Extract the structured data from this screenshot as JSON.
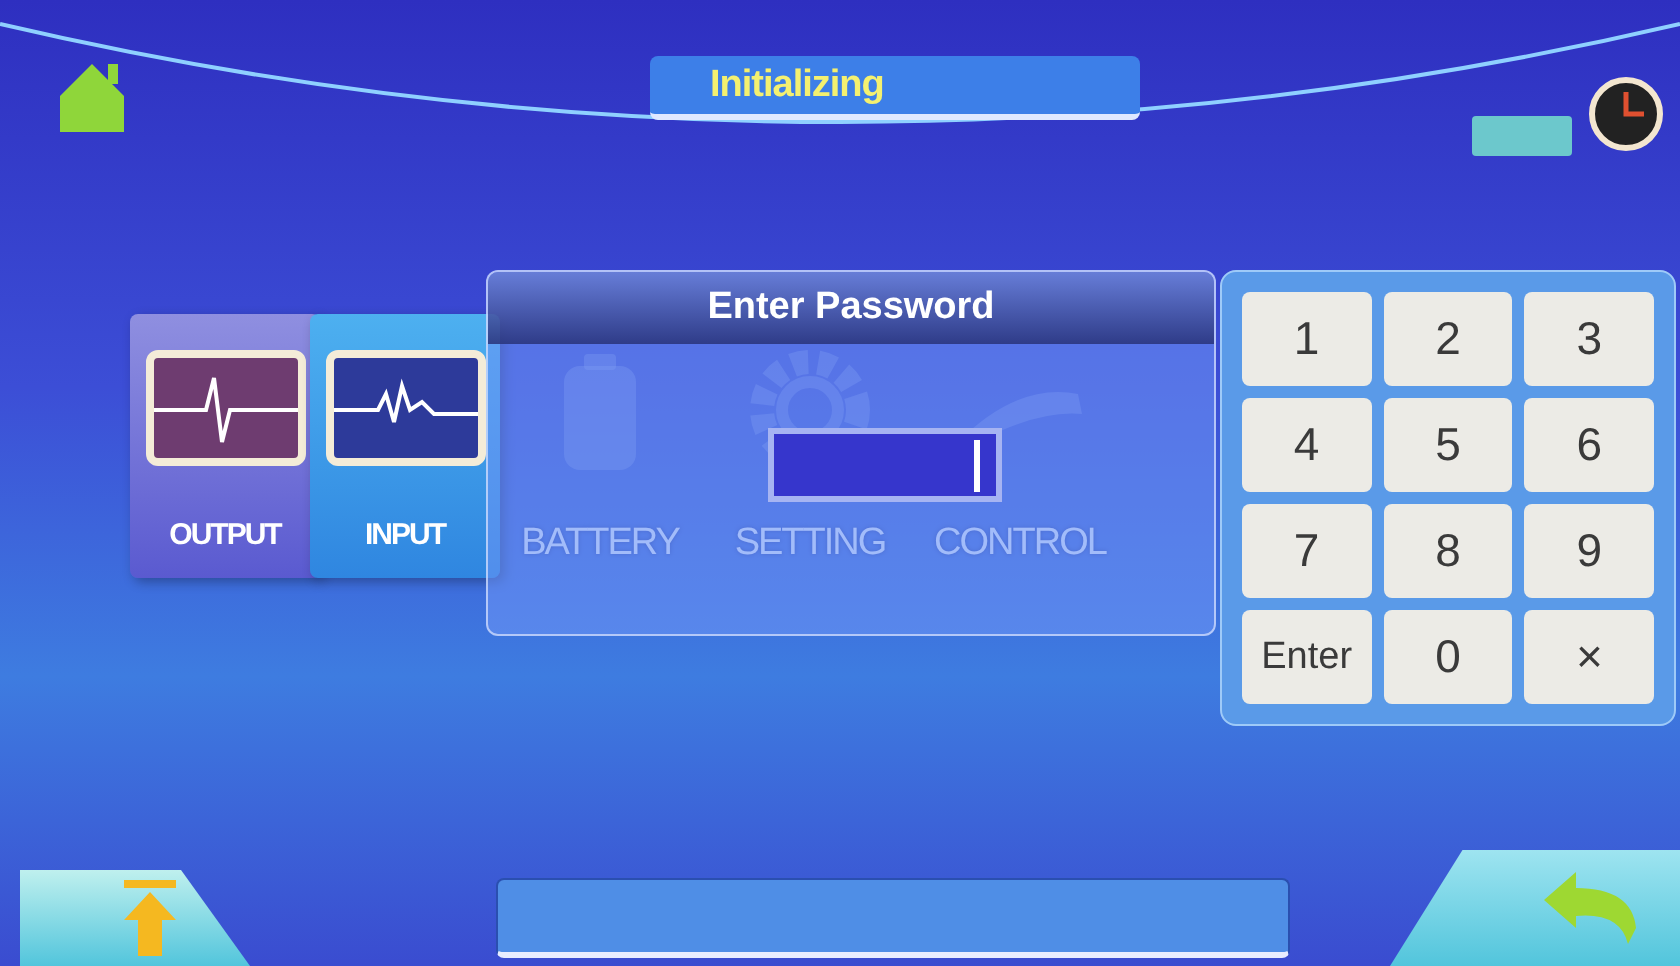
{
  "header": {
    "title": "Initializing"
  },
  "menu": [
    {
      "kind": "card",
      "label": "OUTPUT"
    },
    {
      "kind": "card",
      "label": "INPUT"
    },
    {
      "kind": "plain",
      "label": "BATTERY"
    },
    {
      "kind": "plain",
      "label": "SETTING"
    },
    {
      "kind": "plain",
      "label": "CONTROL"
    }
  ],
  "dialog": {
    "title": "Enter Password"
  },
  "keypad": {
    "keys": [
      {
        "label": "1"
      },
      {
        "label": "2"
      },
      {
        "label": "3"
      },
      {
        "label": "4"
      },
      {
        "label": "5"
      },
      {
        "label": "6"
      },
      {
        "label": "7"
      },
      {
        "label": "8"
      },
      {
        "label": "9"
      },
      {
        "label": "Enter"
      },
      {
        "label": "0"
      },
      {
        "label": "×"
      }
    ]
  }
}
